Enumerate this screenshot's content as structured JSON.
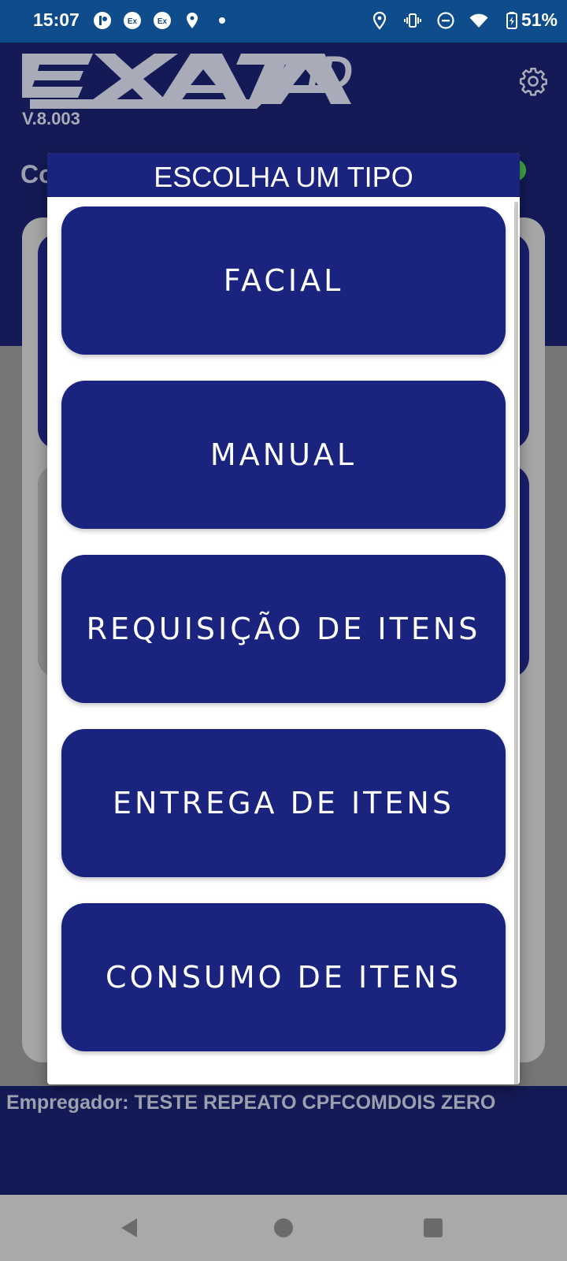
{
  "status_bar": {
    "time": "15:07",
    "battery": "51%"
  },
  "app": {
    "version": "V.8.003",
    "background_title_fragment": "Co",
    "employer_line": "Empregador: TESTE REPEATO CPFCOMDOIS ZERO"
  },
  "dialog": {
    "title": "ESCOLHA UM TIPO",
    "options": [
      "FACIAL",
      "MANUAL",
      "REQUISIÇÃO DE ITENS",
      "ENTREGA DE ITENS",
      "CONSUMO DE ITENS"
    ]
  },
  "colors": {
    "status_bar": "#0f4c8c",
    "header": "#141a55",
    "button": "#1a237e",
    "overlay": "#767676"
  },
  "icons": {
    "status_left": [
      "app-notification-icon",
      "ex-app-icon",
      "ex-app-icon",
      "location-pin-icon",
      "dot-icon"
    ],
    "status_right": [
      "location-icon",
      "vibrate-icon",
      "do-not-disturb-icon",
      "wifi-icon",
      "battery-charging-icon"
    ],
    "nav": [
      "back-icon",
      "home-icon",
      "recents-icon"
    ]
  }
}
